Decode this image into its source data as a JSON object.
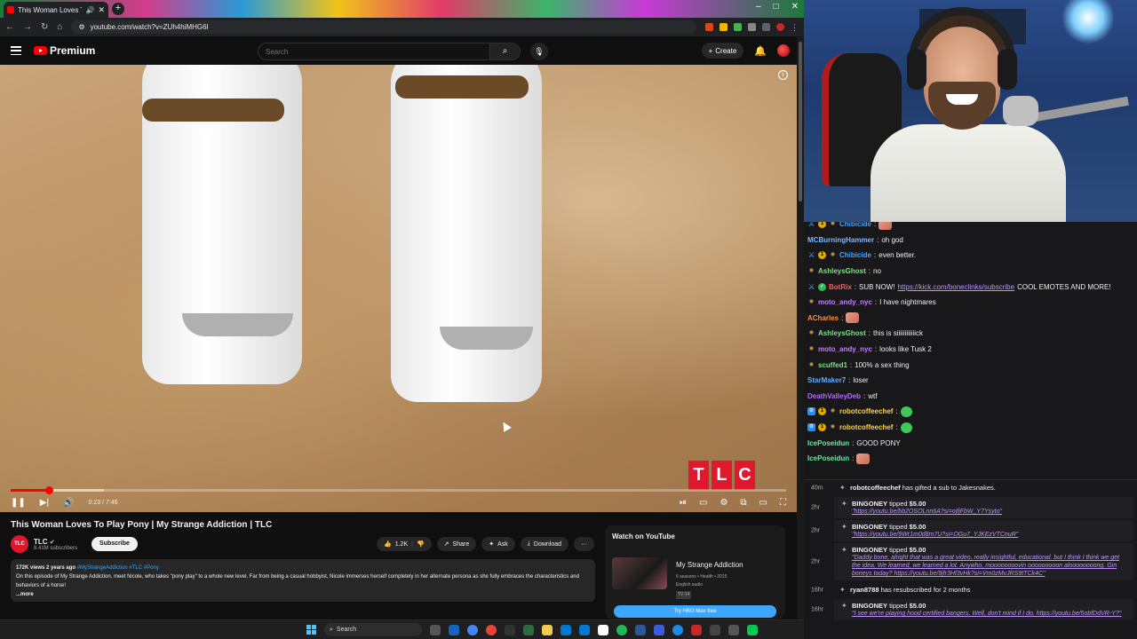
{
  "browser": {
    "tab_title": "This Woman Loves To Play",
    "url": "youtube.com/watch?v=ZUh4hiMHG6I",
    "window_controls": [
      "–",
      "□",
      "✕"
    ]
  },
  "youtube": {
    "logo_text": "Premium",
    "search_placeholder": "Search",
    "create_label": "Create",
    "player": {
      "time": "0:23 / 7:46",
      "progress_fraction": 0.049,
      "tlc_letters": [
        "T",
        "L",
        "C"
      ]
    },
    "video_title": "This Woman Loves To Play Pony | My Strange Addiction | TLC",
    "channel": {
      "name": "TLC",
      "avatar_text": "TLC",
      "subscribers": "8.41M subscribers",
      "subscribe_label": "Subscribe"
    },
    "actions": {
      "likes": "1.2K",
      "share": "Share",
      "ask": "Ask",
      "download": "Download",
      "more": "···"
    },
    "description": {
      "meta": "172K views  2 years ago",
      "tags": "#MyStrangeAddiction #TLC #Pony",
      "text": "On this episode of My Strange Addiction, meet Nicole, who takes \"pony play\" to a whole new level. Far from being a casual hobbyist, Nicole immerses herself completely in her alternate persona as she fully embraces the characteristics and behaviors of a horse!",
      "more": "...more"
    },
    "watch_card": {
      "heading": "Watch on YouTube",
      "show_title": "My Strange Addiction",
      "show_meta": "6 seasons • Health • 2015",
      "audio": "English audio",
      "rating": "TV-14",
      "button": "Try HBO Max free"
    }
  },
  "chat": {
    "messages": [
      {
        "user": "Chibicide",
        "color": "#4aa3ff",
        "badges": [
          "sword",
          "gold",
          "vip"
        ],
        "text": "",
        "emote": true
      },
      {
        "user": "MCBurningHammer",
        "color": "#7fb7ff",
        "badges": [],
        "text": "oh god"
      },
      {
        "user": "Chibicide",
        "color": "#4aa3ff",
        "badges": [
          "sword",
          "gold",
          "vip"
        ],
        "text": "even better."
      },
      {
        "user": "AshleysGhost",
        "color": "#7be37b",
        "badges": [
          "vip"
        ],
        "text": "no"
      },
      {
        "user": "BotRix",
        "color": "#ff5c5c",
        "badges": [
          "sword",
          "mod"
        ],
        "text": "SUB NOW! ",
        "link": "https://kick.com/boneclinks/subscribe",
        "text2": " COOL EMOTES AND MORE!"
      },
      {
        "user": "moto_andy_nyc",
        "color": "#c77dff",
        "badges": [
          "vip"
        ],
        "text": "I have nightmares"
      },
      {
        "user": "ACharles",
        "color": "#ff8c3a",
        "badges": [],
        "text": "",
        "emote": true
      },
      {
        "user": "AshleysGhost",
        "color": "#7be37b",
        "badges": [
          "vip"
        ],
        "text": "this is siiiiiiiiiiiick"
      },
      {
        "user": "moto_andy_nyc",
        "color": "#c77dff",
        "badges": [
          "vip"
        ],
        "text": "looks like Tusk 2"
      },
      {
        "user": "scuffed1",
        "color": "#7be37b",
        "badges": [
          "vip"
        ],
        "text": "100% a sex thing"
      },
      {
        "user": "StarMaker7",
        "color": "#5fb0ff",
        "badges": [],
        "text": "loser"
      },
      {
        "user": "DeathValleyDeb",
        "color": "#b36bff",
        "badges": [],
        "text": "wtf"
      },
      {
        "user": "robotcoffeechef",
        "color": "#ffd24a",
        "badges": [
          "bot",
          "gold",
          "vip"
        ],
        "text": "",
        "emote_green": true
      },
      {
        "user": "robotcoffeechef",
        "color": "#ffd24a",
        "badges": [
          "bot",
          "gold",
          "vip"
        ],
        "text": "",
        "emote_green": true
      },
      {
        "user": "IcePoseidun",
        "color": "#6ee7a0",
        "badges": [],
        "text": "GOOD PONY"
      },
      {
        "user": "IcePoseidun",
        "color": "#6ee7a0",
        "badges": [],
        "text": "",
        "emote": true
      }
    ]
  },
  "events": [
    {
      "age": "40m",
      "user": "robotcoffeechef",
      "text": " has gifted a sub to ",
      "target": "Jakesnakes."
    },
    {
      "age": "2hr",
      "user": "BINGONEY",
      "text": " tipped ",
      "amount": "$5.00",
      "msg": "\"https://youtu.be/bb2OSOLnn6A?si=ojfjFbW_Y7Ysyto\""
    },
    {
      "age": "2hr",
      "user": "BINGONEY",
      "text": " tipped ",
      "amount": "$5.00",
      "msg": "\"https://youtu.be/9Wr1m0d8m7U?si=OGu7_YJKEzVTCnuR\""
    },
    {
      "age": "2hr",
      "user": "BINGONEY",
      "text": " tipped ",
      "amount": "$5.00",
      "msg": "\"Daddy bone, alright that was a great video, really insightful, educational. but I think I think we get the idea. We learned, we learned a lot. Anywho, moooooooovin ooooooooon aloooooooong. Gin boneys today? https://youtu.be/9jfr3Hf3vHk?si=Vm0zMvJRS9tTCk4C\""
    },
    {
      "age": "16hr",
      "user": "ryan8788",
      "text": " has resubscribed for 2 months",
      "amount": "",
      "msg": ""
    },
    {
      "age": "16hr",
      "user": "BINGONEY",
      "text": " tipped ",
      "amount": "$5.00",
      "msg": "\"I see we're playing hood certified bangers. Well, don't mind if I do. https://youtu.be/5obfDdVR-Y?\""
    }
  ],
  "taskbar": {
    "search_label": "Search"
  },
  "colors": {
    "yt_red": "#ff0000",
    "chat_bg": "#18181b",
    "link": "#bf94ff",
    "accent_blue": "#3ea6ff"
  }
}
